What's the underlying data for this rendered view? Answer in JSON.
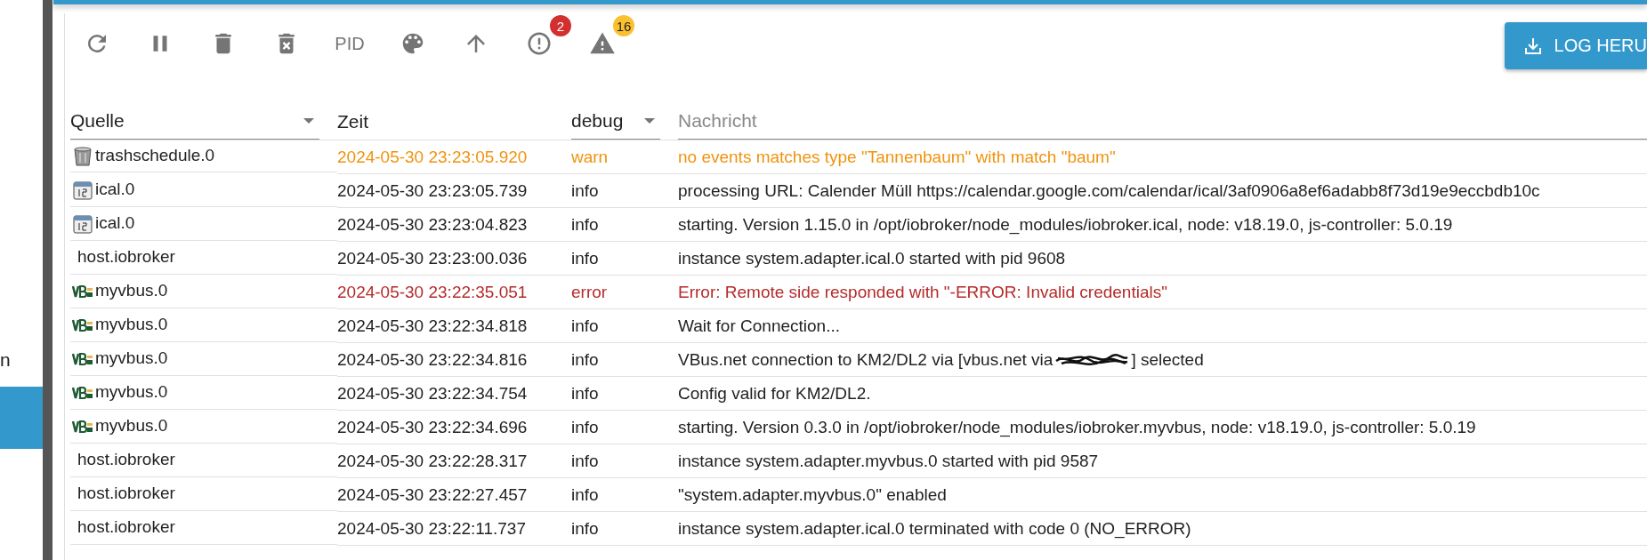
{
  "sidebar": {
    "items": [
      {
        "label": "n",
        "selected": false
      },
      {
        "selected": true
      }
    ]
  },
  "toolbar": {
    "buttons": [
      {
        "kind": "reload"
      },
      {
        "kind": "pause"
      },
      {
        "kind": "delete"
      },
      {
        "kind": "delete-x"
      },
      {
        "kind": "text",
        "label": "PID"
      },
      {
        "kind": "palette"
      },
      {
        "kind": "arrow-up"
      },
      {
        "kind": "error",
        "badge": "2",
        "color": "#d32f2f"
      },
      {
        "kind": "warning",
        "badge": "16",
        "color": "#fbc02d"
      }
    ],
    "download_button": {
      "label": "LOG HERU"
    }
  },
  "table": {
    "header": {
      "source_filter": {
        "value": "Quelle"
      },
      "time_heading": "Zeit",
      "level_filter": {
        "value": "debug"
      },
      "message_filter": {
        "placeholder": "Nachricht"
      }
    },
    "rows": [
      {
        "kind": "trash",
        "source": "trashschedule.0",
        "time": "2024-05-30 23:23:05.920",
        "level": "warn",
        "warning": true,
        "error": false,
        "message": "no events matches type \"Tannenbaum\" with match \"baum\""
      },
      {
        "kind": "calendar",
        "source": "ical.0",
        "time": "2024-05-30 23:23:05.739",
        "level": "info",
        "warning": false,
        "error": false,
        "message": "processing URL: Calender Müll https://calendar.google.com/calendar/ical/3af0906a8ef6adabb8f73d19e9eccbdb10c"
      },
      {
        "kind": "calendar",
        "source": "ical.0",
        "time": "2024-05-30 23:23:04.823",
        "level": "info",
        "warning": false,
        "error": false,
        "message": "starting. Version 1.15.0 in /opt/iobroker/node_modules/iobroker.ical, node: v18.19.0, js-controller: 5.0.19"
      },
      {
        "kind": "plain",
        "source": "host.iobroker",
        "time": "2024-05-30 23:23:00.036",
        "level": "info",
        "warning": false,
        "error": false,
        "message": "instance system.adapter.ical.0 started with pid 9608"
      },
      {
        "kind": "vbus",
        "source": "myvbus.0",
        "time": "2024-05-30 23:22:35.051",
        "level": "error",
        "warning": false,
        "error": true,
        "message": "Error: Remote side responded with \"-ERROR: Invalid credentials\""
      },
      {
        "kind": "vbus",
        "source": "myvbus.0",
        "time": "2024-05-30 23:22:34.818",
        "level": "info",
        "warning": false,
        "error": false,
        "message": "Wait for Connection..."
      },
      {
        "kind": "vbus",
        "source": "myvbus.0",
        "time": "2024-05-30 23:22:34.816",
        "level": "info",
        "warning": false,
        "error": false,
        "message": "VBus.net connection to KM2/DL2 via [vbus.net via",
        "redacted": true,
        "message_after": "] selected"
      },
      {
        "kind": "vbus",
        "source": "myvbus.0",
        "time": "2024-05-30 23:22:34.754",
        "level": "info",
        "warning": false,
        "error": false,
        "message": "Config valid for KM2/DL2."
      },
      {
        "kind": "vbus",
        "source": "myvbus.0",
        "time": "2024-05-30 23:22:34.696",
        "level": "info",
        "warning": false,
        "error": false,
        "message": "starting. Version 0.3.0 in /opt/iobroker/node_modules/iobroker.myvbus, node: v18.19.0, js-controller: 5.0.19"
      },
      {
        "kind": "plain",
        "source": "host.iobroker",
        "time": "2024-05-30 23:22:28.317",
        "level": "info",
        "warning": false,
        "error": false,
        "message": "instance system.adapter.myvbus.0 started with pid 9587"
      },
      {
        "kind": "plain",
        "source": "host.iobroker",
        "time": "2024-05-30 23:22:27.457",
        "level": "info",
        "warning": false,
        "error": false,
        "message": "\"system.adapter.myvbus.0\" enabled"
      },
      {
        "kind": "plain",
        "source": "host.iobroker",
        "time": "2024-05-30 23:22:11.737",
        "level": "info",
        "warning": false,
        "error": false,
        "message": "instance system.adapter.ical.0 terminated with code 0 (NO_ERROR)"
      }
    ]
  }
}
